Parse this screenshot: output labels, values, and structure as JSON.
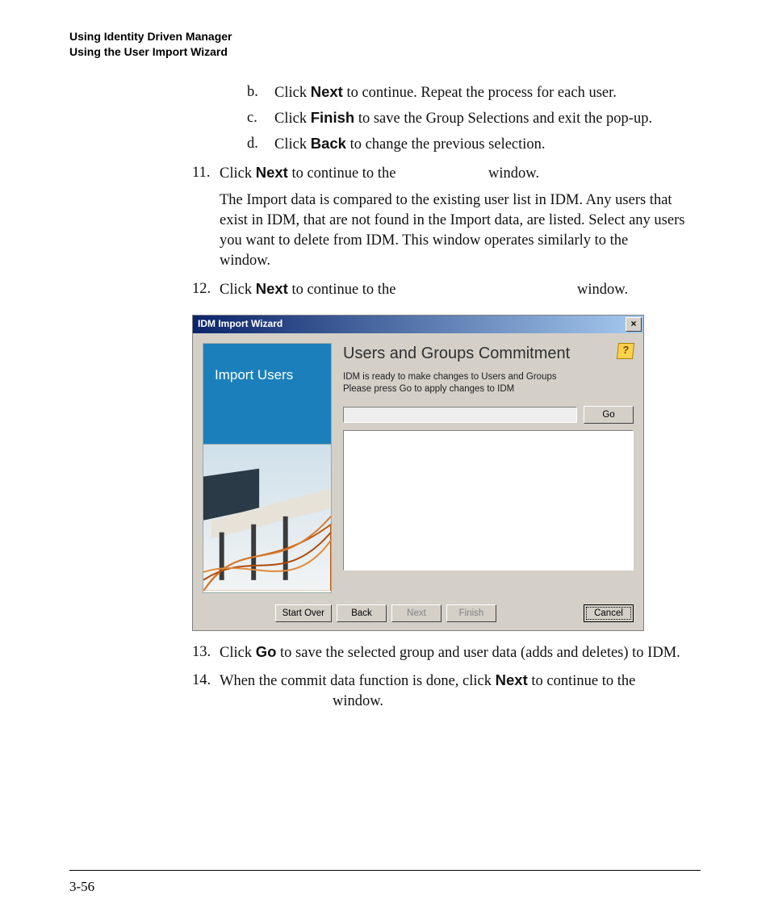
{
  "header": {
    "line1": "Using Identity Driven Manager",
    "line2": "Using the User Import Wizard"
  },
  "sub_items": [
    {
      "marker": "b.",
      "pre": "Click ",
      "bold": "Next",
      "post": " to continue. Repeat the process for each user."
    },
    {
      "marker": "c.",
      "pre": "Click ",
      "bold": "Finish",
      "post": " to save the Group Selections and exit the pop-up."
    },
    {
      "marker": "d.",
      "pre": "Click ",
      "bold": "Back",
      "post": " to change the previous selection."
    }
  ],
  "step11": {
    "marker": "11.",
    "pre": "Click ",
    "bold": "Next",
    "mid": " to continue to the ",
    "post": "window.",
    "para2_a": "The Import data is compared to the existing user list in IDM. Any users that exist in IDM, that are not found in the Import data, are listed. Select any users you want to delete from IDM. This window operates similarly to the ",
    "para2_b": "window."
  },
  "step12": {
    "marker": "12.",
    "pre": "Click ",
    "bold": "Next",
    "mid": " to continue to the ",
    "post": "window."
  },
  "wizard": {
    "titlebar": "IDM Import Wizard",
    "close": "×",
    "left_caption": "Import Users",
    "title": "Users and Groups Commitment",
    "help": "?",
    "desc1": "IDM is ready to make changes to Users and Groups",
    "desc2": "Please press Go to apply changes to IDM",
    "go": "Go",
    "buttons": {
      "start_over": "Start Over",
      "back": "Back",
      "next": "Next",
      "finish": "Finish",
      "cancel": "Cancel"
    }
  },
  "step13": {
    "marker": "13.",
    "pre": "Click ",
    "bold": "Go",
    "post": " to save the selected group and user data (adds and deletes) to IDM."
  },
  "step14": {
    "marker": "14.",
    "pre": "When the commit data function is done, click ",
    "bold": "Next",
    "mid": " to continue to the ",
    "post": "window."
  },
  "page_number": "3-56"
}
